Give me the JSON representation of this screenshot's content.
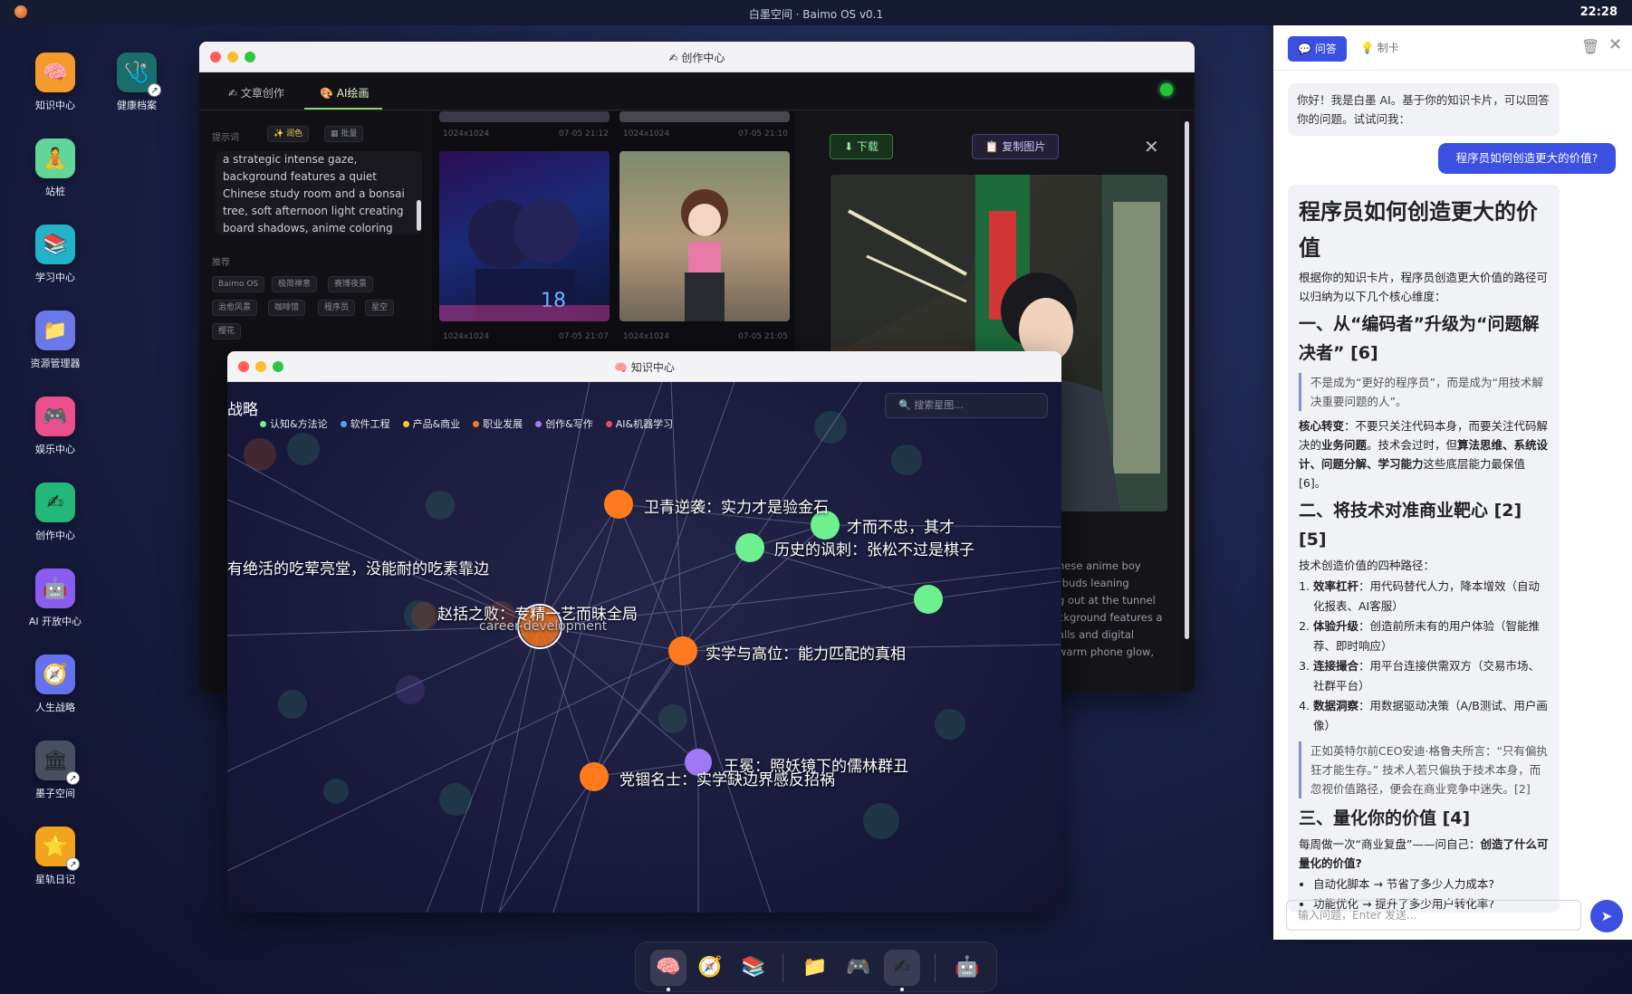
{
  "menubar": {
    "title": "白墨空间 · Baimo OS v0.1",
    "time": "22:28"
  },
  "desktop": {
    "icons": [
      {
        "label": "知识中心",
        "icon": "brain-icon",
        "glyph": "🧠",
        "color": "#f59b2b"
      },
      {
        "label": "健康档案",
        "icon": "stethoscope-icon",
        "glyph": "🩺",
        "color": "#1a6d6a"
      },
      {
        "label": "站桩",
        "icon": "meditation-icon",
        "glyph": "🧘",
        "color": "#63d49a"
      },
      {
        "label": "学习中心",
        "icon": "books-icon",
        "glyph": "📚",
        "color": "#22b3c9"
      },
      {
        "label": "资源管理器",
        "icon": "folder-icon",
        "glyph": "📁",
        "color": "#6a78e8"
      },
      {
        "label": "娱乐中心",
        "icon": "gamepad-icon",
        "glyph": "🎮",
        "color": "#ec4f8d"
      },
      {
        "label": "创作中心",
        "icon": "writing-hand-icon",
        "glyph": "✍",
        "color": "#24b77a"
      },
      {
        "label": "AI 开放中心",
        "icon": "robot-icon",
        "glyph": "🤖",
        "color": "#8b5cf0"
      },
      {
        "label": "人生战略",
        "icon": "compass-icon",
        "glyph": "🧭",
        "color": "#6671ee"
      },
      {
        "label": "墨子空间",
        "icon": "temple-icon",
        "glyph": "🏛",
        "color": "#475063"
      },
      {
        "label": "星轨日记",
        "icon": "star-icon",
        "glyph": "⭐",
        "color": "#f3a41f"
      }
    ]
  },
  "creation": {
    "title": "✍ 创作中心",
    "tabs": [
      {
        "label": "✍ 文章创作"
      },
      {
        "label": "🎨 AI绘画"
      }
    ],
    "prompt_label": "提示词",
    "btn_color": "✨ 润色",
    "btn_batch": "▦ 批量",
    "prompt_text": "a strategic intense gaze, background features a quiet Chinese study room and a bonsai tree, soft afternoon light creating board shadows, anime coloring",
    "rec_label": "推荐",
    "chips": [
      "Baimo OS",
      "极简禅意",
      "赛博夜景",
      "治愈风景",
      "咖啡馆",
      "程序员",
      "星空",
      "樱花"
    ],
    "thumbs_meta": [
      {
        "size": "1024x1024",
        "time": "07-05 21:12"
      },
      {
        "size": "1024x1024",
        "time": "07-05 21:10"
      },
      {
        "size": "1024x1024",
        "time": "07-05 21:07"
      },
      {
        "size": "1024x1024",
        "time": "07-05 21:05"
      }
    ],
    "btn_download": "⬇ 下载",
    "btn_copy": "📋 复制图片",
    "prompt_detail": "nese anime boy\nrbuds leaning\ng out at the tunnel\nckground features a\nalls and digital\nwarm phone glow,",
    "left_cut": "战略"
  },
  "knowledge": {
    "title": "🧠 知识中心",
    "search_placeholder": "搜索星图...",
    "legend": [
      {
        "label": "认知&方法论",
        "color": "#6ef08f"
      },
      {
        "label": "软件工程",
        "color": "#4aa8f2"
      },
      {
        "label": "产品&商业",
        "color": "#f0c93a"
      },
      {
        "label": "职业发展",
        "color": "#f37a22"
      },
      {
        "label": "创作&写作",
        "color": "#a078f5"
      },
      {
        "label": "AI&机器学习",
        "color": "#f2466a"
      }
    ],
    "nodes": [
      {
        "label": "卫青逆袭：实力才是验金石"
      },
      {
        "label": "才而不忠，其才"
      },
      {
        "label": "历史的讽刺：张松不过是棋子"
      },
      {
        "label": "有绝活的吃荤亮堂，没能耐的吃素靠边"
      },
      {
        "label": "赵括之败：专精一艺而昧全局"
      },
      {
        "label": "career-development"
      },
      {
        "label": "实学与高位：能力匹配的真相"
      },
      {
        "label": "王冕：照妖镜下的儒林群丑"
      },
      {
        "label": "党锢名士：实学缺边界感反招祸"
      }
    ]
  },
  "chat": {
    "tab_qa": "💬 问答",
    "tab_card": "💡 制卡",
    "greeting": "你好！我是白墨 AI。基于你的知识卡片，可以回答你的问题。试试问我：",
    "user_msg": "程序员如何创造更大的价值?",
    "answer": {
      "title": "程序员如何创造更大的价值",
      "intro": "根据你的知识卡片，程序员创造更大价值的路径可以归纳为以下几个核心维度：",
      "s1": "一、从“编码者”升级为“问题解决者” [6]",
      "q1": "不是成为“更好的程序员”，而是成为“用技术解决重要问题的人”。",
      "p1a": "核心转变",
      "p1b": "：不要只关注代码本身，而要关注代码解决的",
      "p1c": "业务问题",
      "p1d": "。技术会过时，但",
      "p1e": "算法思维、系统设计、问题分解、学习能力",
      "p1f": "这些底层能力最保值 [6]。",
      "s2": "二、将技术对准商业靶心 [2][5]",
      "p2": "技术创造价值的四种路径：",
      "ol": [
        {
          "b": "效率杠杆",
          "t": "：用代码替代人力，降本增效（自动化报表、AI客服）"
        },
        {
          "b": "体验升级",
          "t": "：创造前所未有的用户体验（智能推荐、即时响应）"
        },
        {
          "b": "连接撮合",
          "t": "：用平台连接供需双方（交易市场、社群平台）"
        },
        {
          "b": "数据洞察",
          "t": "：用数据驱动决策（A/B测试、用户画像）"
        }
      ],
      "q2": "正如英特尔前CEO安迪·格鲁夫所言：“只有偏执狂才能生存。” 技术人若只偏执于技术本身，而忽视价值路径，便会在商业竞争中迷失。[2]",
      "s3": "三、量化你的价值 [4]",
      "p3a": "每周做一次“商业复盘”——问自己：",
      "p3b": "创造了什么可量化的价值?",
      "ul": [
        "自动化脚本 → 节省了多少人力成本?",
        "功能优化 → 提升了多少用户转化率?"
      ]
    },
    "input_placeholder": "输入问题，Enter 发送...",
    "send": "➤"
  },
  "dock": {
    "items": [
      {
        "icon": "brain-icon",
        "glyph": "🧠",
        "active": true
      },
      {
        "icon": "compass-icon",
        "glyph": "🧭",
        "active": false
      },
      {
        "icon": "books-icon",
        "glyph": "📚",
        "active": false
      },
      {
        "icon": "folder-icon",
        "glyph": "📁",
        "active": false
      },
      {
        "icon": "gamepad-icon",
        "glyph": "🎮",
        "active": false
      },
      {
        "icon": "writing-hand-icon",
        "glyph": "✍",
        "active": true
      },
      {
        "icon": "robot-icon",
        "glyph": "🤖",
        "active": false
      }
    ]
  }
}
